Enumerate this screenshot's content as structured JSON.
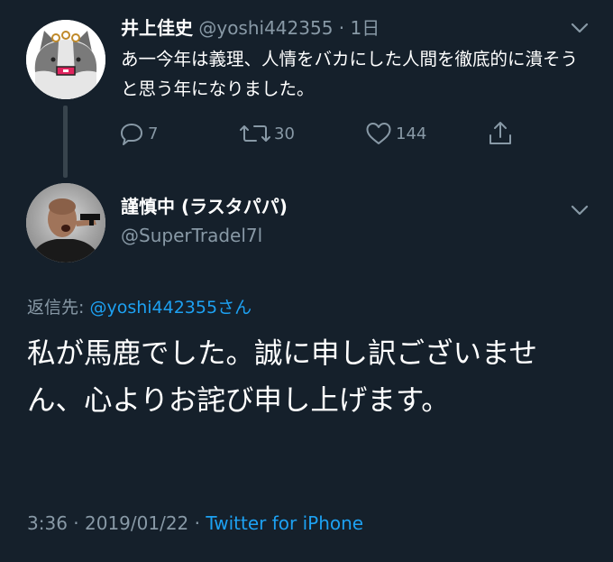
{
  "parent_tweet": {
    "author_name": "井上佳史",
    "author_handle": "@yoshi442355",
    "separator": "·",
    "time_ago": "1日",
    "text": "あ一今年は義理、人情をバカにした人間を徹底的に潰そうと思う年になりました。",
    "actions": {
      "reply_count": "7",
      "retweet_count": "30",
      "like_count": "144"
    },
    "avatar_icon": "cat-avatar"
  },
  "main_tweet": {
    "author_name": "謹慎中 (ラスタパパ)",
    "author_handle": "@SuperTradel7l",
    "avatar_icon": "person-avatar",
    "reply_to_label": "返信先: ",
    "reply_to_handle": "@yoshi442355",
    "reply_to_suffix": "さん",
    "text": "私が馬鹿でした。誠に申し訳ございません、心よりお詫び申し上げます。",
    "time": "3:36",
    "separator": "·",
    "date": "2019/01/22",
    "separator2": "·",
    "source": "Twitter for iPhone"
  },
  "colors": {
    "background": "#15202b",
    "muted": "#8899a6",
    "link": "#1da1f2",
    "thread_line": "#38444d"
  }
}
